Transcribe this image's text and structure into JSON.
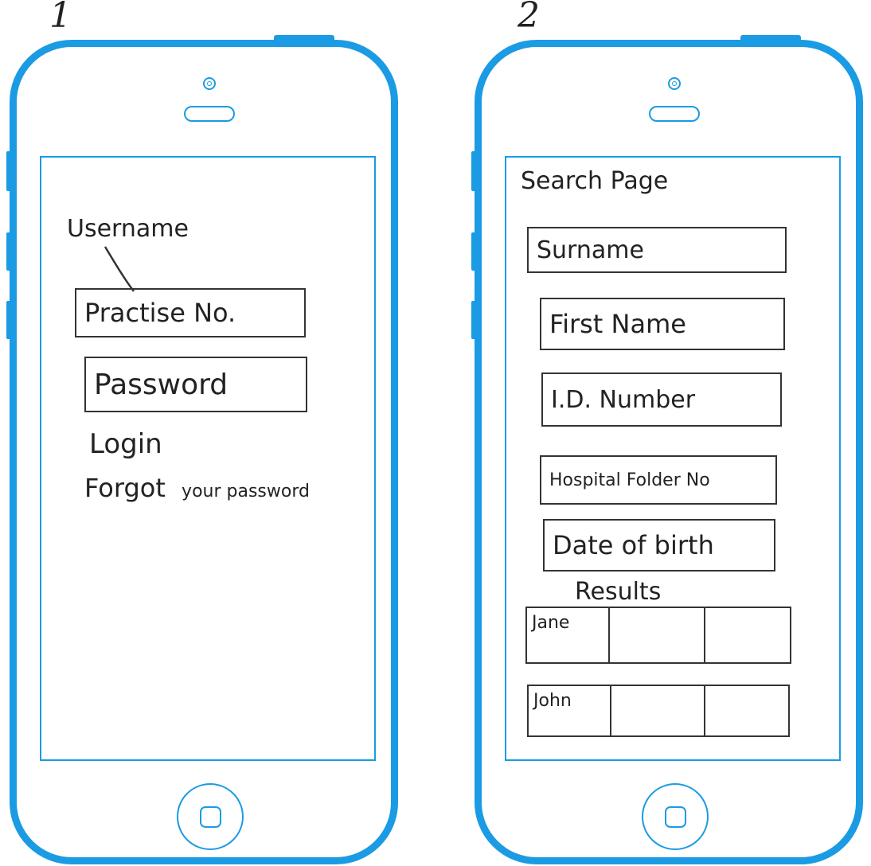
{
  "phones": [
    {
      "number": "1",
      "annotation": "Username",
      "fields": {
        "username_placeholder": "Practise No.",
        "password_placeholder": "Password"
      },
      "login_label": "Login",
      "forgot_label": "Forgot",
      "forgot_suffix": "your password"
    },
    {
      "number": "2",
      "page_title": "Search Page",
      "fields": {
        "surname": "Surname",
        "first_name": "First Name",
        "id_number": "I.D. Number",
        "hospital_folder": "Hospital Folder No",
        "dob": "Date of birth"
      },
      "results_label": "Results",
      "results": [
        {
          "name": "Jane"
        },
        {
          "name": "John"
        }
      ]
    }
  ],
  "colors": {
    "phone_outline": "#1b9be3",
    "ink": "#333333"
  }
}
